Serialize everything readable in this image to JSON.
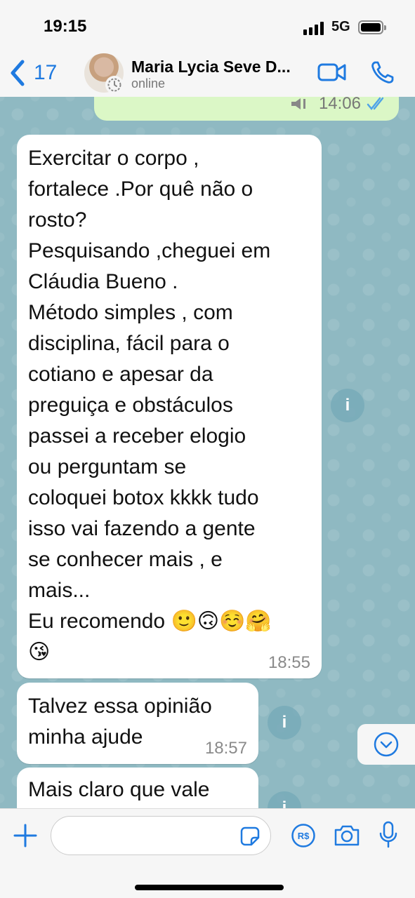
{
  "status_bar": {
    "time": "19:15",
    "network": "5G"
  },
  "header": {
    "back_count": "17",
    "contact_name": "Maria Lycia Seve D...",
    "contact_status": "online"
  },
  "colors": {
    "accent": "#1f7ae0",
    "outgoing_bubble": "#dbf7c6",
    "incoming_bubble": "#ffffff",
    "chat_background": "#8fb9c2",
    "read_ticks": "#4fa3e8"
  },
  "messages": [
    {
      "direction": "outgoing",
      "time": "14:06",
      "status": "read"
    },
    {
      "direction": "incoming",
      "text": "Exercitar o corpo ,\nfortalece .Por quê não o\nrosto?\nPesquisando ,cheguei em\nCláudia Bueno .\nMétodo simples , com\ndisciplina, fácil para o\ncotiano e apesar da\npreguiça e obstáculos\npassei a receber elogio\nou perguntam se\ncoloquei botox kkkk tudo\nisso vai fazendo a gente\nse conhecer mais , e\nmais...\nEu recomendo 🙂🙃☺️🤗\n😘",
      "time": "18:55"
    },
    {
      "direction": "incoming",
      "text": "Talvez essa opinião\nminha ajude",
      "time": "18:57"
    },
    {
      "direction": "incoming",
      "text": "Mais claro que vale"
    }
  ],
  "icons": {
    "back": "chevron-left-icon",
    "video": "video-camera-icon",
    "call": "phone-icon",
    "info": "info-icon",
    "scroll_down": "chevron-down-icon",
    "plus": "plus-icon",
    "sticker": "sticker-icon",
    "payment": "payment-rs-icon",
    "camera": "camera-icon",
    "mic": "microphone-icon"
  },
  "input_bar": {
    "payment_label": "R$",
    "info_label": "i"
  }
}
